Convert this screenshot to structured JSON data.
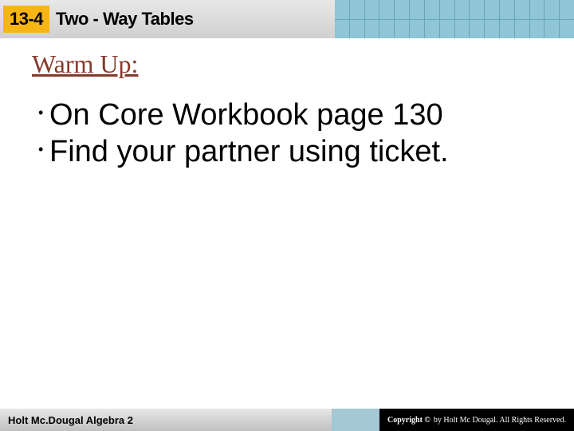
{
  "header": {
    "lesson_number": "13-4",
    "lesson_title": "Two - Way Tables"
  },
  "content": {
    "heading": "Warm Up:",
    "bullets": [
      "On Core Workbook page 130",
      "Find your partner using ticket."
    ]
  },
  "footer": {
    "book": "Holt Mc.Dougal Algebra 2",
    "copyright_label": "Copyright ©",
    "copyright_text": "by Holt Mc Dougal. All Rights Reserved."
  }
}
